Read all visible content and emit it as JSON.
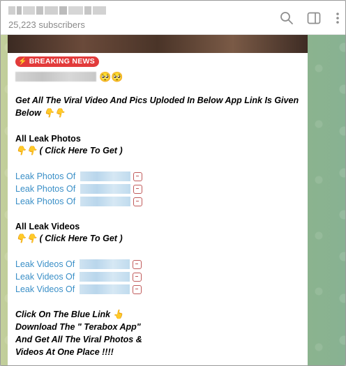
{
  "header": {
    "subscribers": "25,223 subscribers",
    "icons": [
      "search-icon",
      "sidebar-toggle-icon",
      "more-vertical-icon"
    ]
  },
  "post": {
    "badge_icon": "⚡",
    "badge": "BREAKING NEWS",
    "name_emoji": "🥺🥺",
    "intro_line1": "Get All The Viral Video And Pics Uploded In Below App Link Is Given",
    "intro_line2": "Below 👇👇",
    "photos_heading": "All Leak Photos",
    "photos_hint": "👇👇 ( Click Here To Get )",
    "photo_links": [
      "Leak Photos Of ",
      "Leak Photos Of ",
      "Leak Photos Of "
    ],
    "videos_heading": "All Leak Videos",
    "videos_hint": "👇👇 ( Click Here To Get )",
    "video_links": [
      "Leak Videos Of ",
      "Leak Videos Of ",
      "Leak Videos Of "
    ],
    "cta_line1": "Click On The Blue Link 👆",
    "cta_line2": "Download The \" Terabox App\"",
    "cta_line3": "And Get All The Viral Photos &",
    "cta_line4": "Videos At One Place !!!!"
  },
  "colors": {
    "link": "#3a8fc7",
    "badge": "#e23b3b",
    "header_text": "#8a8a8a"
  }
}
